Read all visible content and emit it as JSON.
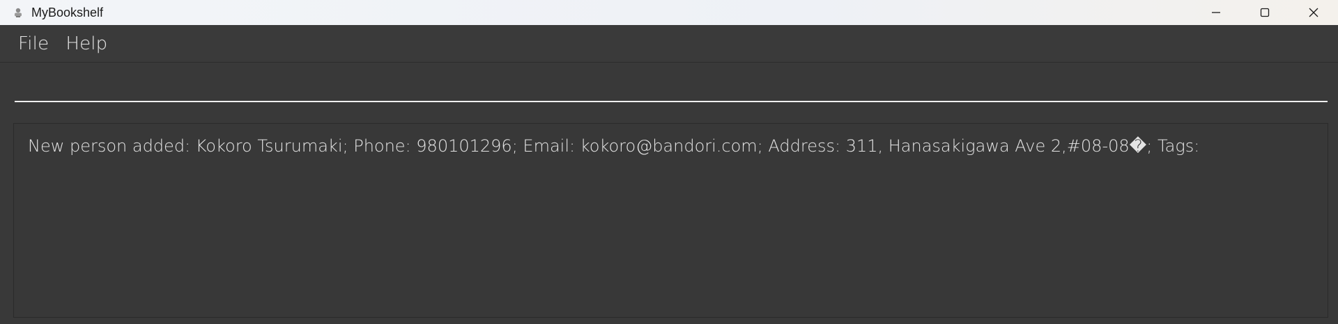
{
  "window": {
    "title": "MyBookshelf",
    "icon": "app-figure-icon",
    "controls": [
      "minimize-icon",
      "maximize-icon",
      "close-icon"
    ]
  },
  "menu": {
    "items": [
      {
        "label": "File"
      },
      {
        "label": "Help"
      }
    ]
  },
  "command": {
    "value": "",
    "placeholder": ""
  },
  "result": {
    "text": "New person added: Kokoro Tsurumaki; Phone: 980101296; Email: kokoro@bandori.com; Address: 311, Hanasakigawa Ave 2,#08-08�; Tags:"
  },
  "colors": {
    "background": "#393939",
    "titlebar": "#f0f3f7",
    "text": "#e4e4e4",
    "underline": "#f0f0f0"
  }
}
